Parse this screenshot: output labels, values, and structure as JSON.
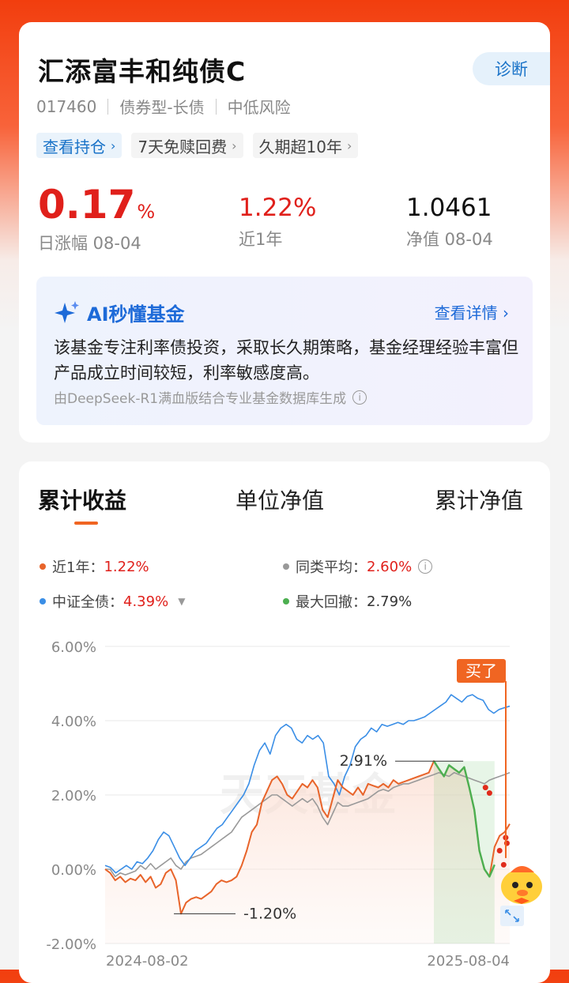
{
  "fund": {
    "name": "汇添富丰和纯债C",
    "diagnose_label": "诊断",
    "code": "017460",
    "type": "债券型-长债",
    "risk": "中低风险",
    "tags": [
      {
        "label": "查看持仓",
        "highlight": true
      },
      {
        "label": "7天免赎回费",
        "highlight": false
      },
      {
        "label": "久期超10年",
        "highlight": false
      }
    ],
    "tag_chevron": "›",
    "daily_change": {
      "value": "0.17",
      "unit": "%",
      "label": "日涨幅 08-04"
    },
    "year_return": {
      "value": "1.22%",
      "label": "近1年"
    },
    "nav": {
      "value": "1.0461",
      "label": "净值 08-04"
    }
  },
  "ai": {
    "title": "AI秒懂基金",
    "more_label": "查看详情 ›",
    "summary": "该基金专注利率债投资，采取长久期策略，基金经理经验丰富但产品成立时间较短，利率敏感度高。",
    "footnote": "由DeepSeek-R1满血版结合专业基金数据库生成",
    "footnote_icon": "info-icon"
  },
  "tabs": [
    {
      "label": "累计收益",
      "active": true
    },
    {
      "label": "单位净值",
      "active": false
    },
    {
      "label": "累计净值",
      "active": false
    }
  ],
  "legend": [
    {
      "name": "近1年",
      "value": "1.22%",
      "color": "#e8642a"
    },
    {
      "name": "同类平均",
      "value": "2.60%",
      "color": "#999999"
    },
    {
      "name": "中证全债",
      "value": "4.39%",
      "color": "#3a8ee6"
    },
    {
      "name": "最大回撤",
      "value": "2.79%",
      "color": "#4caf50"
    }
  ],
  "chart_data": {
    "type": "line",
    "x_start": "2024-08-02",
    "x_end": "2025-08-04",
    "y_ticks": [
      "6.00%",
      "4.00%",
      "2.00%",
      "0.00%",
      "-2.00%"
    ],
    "ylim": [
      -2,
      6
    ],
    "grid": true,
    "legend": "top",
    "watermark": "天天基金",
    "bought_label": "买了",
    "annotations": [
      {
        "text": "2.91%",
        "x_index": 0.885,
        "y": 2.91
      },
      {
        "text": "-1.20%",
        "x_index": 0.17,
        "y": -1.2
      }
    ],
    "series": [
      {
        "name": "近1年",
        "color": "#e8642a",
        "values": [
          0,
          -0.1,
          -0.3,
          -0.2,
          -0.35,
          -0.25,
          -0.3,
          -0.15,
          -0.35,
          -0.2,
          -0.5,
          -0.4,
          -0.1,
          0,
          -0.3,
          -1.2,
          -0.9,
          -0.8,
          -0.75,
          -0.8,
          -0.7,
          -0.6,
          -0.4,
          -0.3,
          -0.35,
          -0.3,
          -0.2,
          0.1,
          0.5,
          1,
          1.2,
          1.8,
          2.1,
          2.4,
          2.5,
          2.3,
          2.0,
          1.9,
          2.1,
          2.3,
          2.2,
          2.4,
          2.2,
          1.6,
          1.4,
          1.9,
          2.4,
          2.2,
          2.1,
          2.0,
          2.2,
          2.0,
          2.3,
          2.25,
          2.2,
          2.3,
          2.2,
          2.4,
          2.3,
          2.35,
          2.4,
          2.45,
          2.5,
          2.55,
          2.6,
          2.91,
          2.7,
          2.5,
          2.8,
          2.7,
          2.6,
          2.75,
          2.2,
          1.6,
          0.5,
          0.0,
          -0.2,
          0.6,
          0.9,
          1.0,
          1.22
        ]
      },
      {
        "name": "同类平均",
        "color": "#999999",
        "values": [
          0,
          0,
          -0.2,
          -0.1,
          -0.15,
          -0.1,
          -0.05,
          0.1,
          0,
          0.15,
          0,
          0.1,
          0.2,
          0.3,
          0.1,
          0,
          0.2,
          0.3,
          0.35,
          0.4,
          0.5,
          0.6,
          0.7,
          0.8,
          0.9,
          1.0,
          1.2,
          1.4,
          1.5,
          1.6,
          1.7,
          1.8,
          1.9,
          2.0,
          2.0,
          1.9,
          1.8,
          1.7,
          1.8,
          1.9,
          1.8,
          1.9,
          1.7,
          1.4,
          1.2,
          1.5,
          1.8,
          1.7,
          1.7,
          1.75,
          1.8,
          1.85,
          1.9,
          2.0,
          2.1,
          2.15,
          2.1,
          2.2,
          2.25,
          2.3,
          2.3,
          2.35,
          2.4,
          2.45,
          2.5,
          2.55,
          2.6,
          2.55,
          2.5,
          2.6,
          2.55,
          2.5,
          2.45,
          2.4,
          2.35,
          2.3,
          2.4,
          2.45,
          2.5,
          2.55,
          2.6
        ]
      },
      {
        "name": "中证全债",
        "color": "#3a8ee6",
        "values": [
          0.1,
          0.05,
          -0.1,
          0,
          0.1,
          0,
          0.2,
          0.15,
          0.3,
          0.5,
          0.8,
          1.0,
          0.9,
          0.6,
          0.3,
          0.1,
          0.3,
          0.5,
          0.6,
          0.7,
          0.9,
          1.1,
          1.2,
          1.4,
          1.6,
          1.8,
          2.0,
          2.3,
          2.8,
          3.2,
          3.4,
          3.1,
          3.6,
          3.8,
          3.9,
          3.8,
          3.5,
          3.4,
          3.6,
          3.5,
          3.6,
          3.4,
          2.5,
          2.3,
          2.0,
          2.5,
          2.8,
          3.3,
          3.5,
          3.6,
          3.8,
          3.7,
          3.9,
          3.85,
          3.9,
          3.95,
          3.9,
          4.0,
          4.0,
          4.05,
          4.1,
          4.2,
          4.3,
          4.4,
          4.5,
          4.7,
          4.6,
          4.5,
          4.65,
          4.7,
          4.6,
          4.55,
          4.3,
          4.2,
          4.3,
          4.35,
          4.39
        ]
      },
      {
        "name": "最大回撤",
        "color": "#4caf50",
        "values": [
          2.91,
          2.7,
          2.5,
          2.8,
          2.7,
          2.6,
          2.75,
          2.2,
          1.6,
          0.5,
          0.0,
          -0.2,
          0.12
        ]
      }
    ]
  }
}
